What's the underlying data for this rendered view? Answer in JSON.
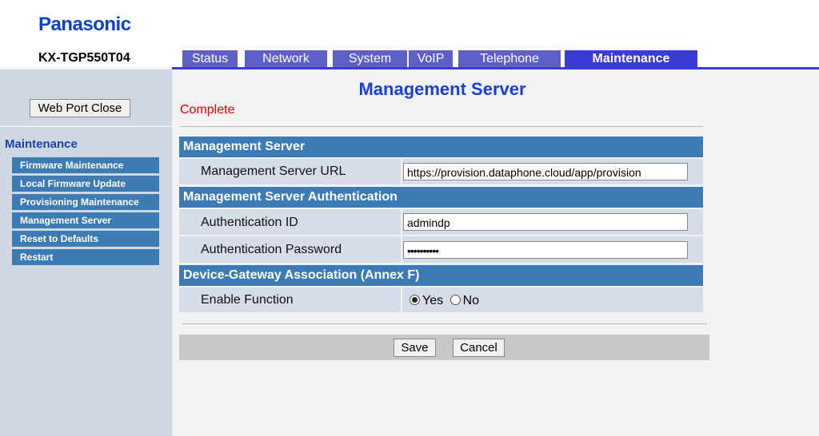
{
  "header": {
    "brand": "Panasonic",
    "model": "KX-TGP550T04",
    "tabs": [
      "Status",
      "Network",
      "System",
      "VoIP",
      "Telephone",
      "Maintenance"
    ],
    "active_tab": "Maintenance"
  },
  "sidebar": {
    "web_port_close_label": "Web Port Close",
    "section_title": "Maintenance",
    "items": [
      {
        "label": "Firmware Maintenance"
      },
      {
        "label": "Local Firmware Update"
      },
      {
        "label": "Provisioning Maintenance"
      },
      {
        "label": "Management Server"
      },
      {
        "label": "Reset to Defaults"
      },
      {
        "label": "Restart"
      }
    ]
  },
  "main": {
    "title": "Management Server",
    "status": "Complete",
    "sections": {
      "server": {
        "heading": "Management Server",
        "url_label": "Management Server URL",
        "url_value": "https://provision.dataphone.cloud/app/provision"
      },
      "auth": {
        "heading": "Management Server Authentication",
        "id_label": "Authentication ID",
        "id_value": "admindp",
        "password_label": "Authentication Password",
        "password_value": "••••••••••"
      },
      "annex": {
        "heading": "Device-Gateway Association (Annex F)",
        "enable_label": "Enable Function",
        "yes_label": "Yes",
        "no_label": "No",
        "selected": "Yes"
      }
    },
    "actions": {
      "save_label": "Save",
      "cancel_label": "Cancel"
    }
  },
  "colors": {
    "brand": "#0b40c8",
    "tab": "#5e5fc8",
    "section": "#3d7bb5",
    "status": "#e00000"
  }
}
